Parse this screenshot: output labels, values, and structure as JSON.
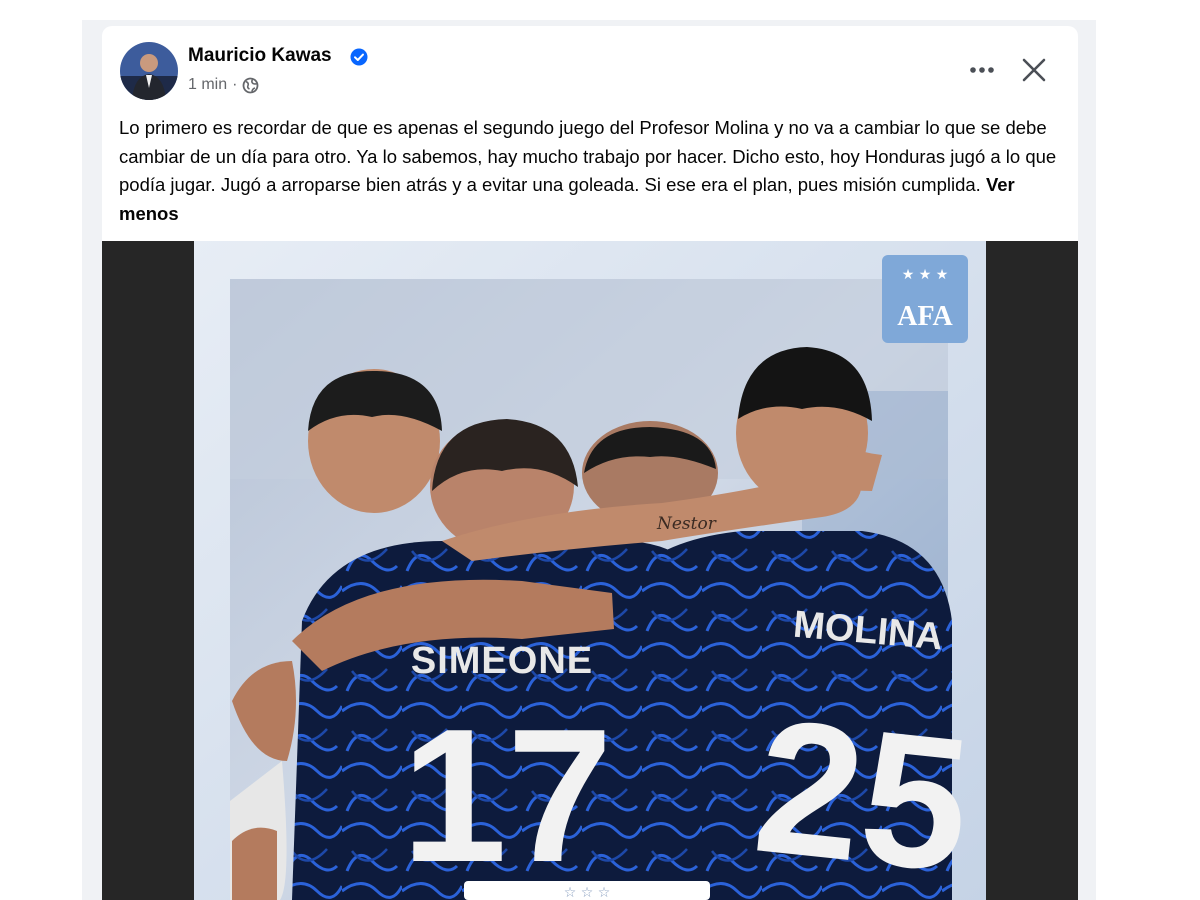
{
  "post": {
    "author": "Mauricio Kawas",
    "timestamp": "1 min",
    "separator": "·",
    "body": "Lo primero es recordar de que es apenas el segundo juego del Profesor Molina y no va a cambiar lo que se debe cambiar de un día para otro. Ya lo sabemos, hay mucho trabajo por hacer. Dicho esto, hoy Honduras jugó a lo que podía jugar. Jugó a arroparse bien atrás y a evitar una goleada. Si ese era el plan, pues misión cumplida.",
    "see_less": "Ver menos"
  },
  "media": {
    "badge_text": "AFA",
    "jersey_left_name": "SIMEONE",
    "jersey_left_number": "17",
    "jersey_right_name": "MOLINA",
    "jersey_right_number": "25",
    "tattoo_text": "Nestor",
    "footer_stars": "☆ ☆ ☆"
  },
  "icons": {
    "verified": "verified-badge-icon",
    "privacy": "globe-icon",
    "more": "more-options-icon",
    "close": "close-icon"
  },
  "colors": {
    "verified_blue": "#0866ff",
    "text_primary": "#050505",
    "text_secondary": "#65676b",
    "jersey_navy": "#0d1b3d",
    "jersey_swirl": "#2b62d9",
    "afa_badge": "#7fa8d8"
  }
}
